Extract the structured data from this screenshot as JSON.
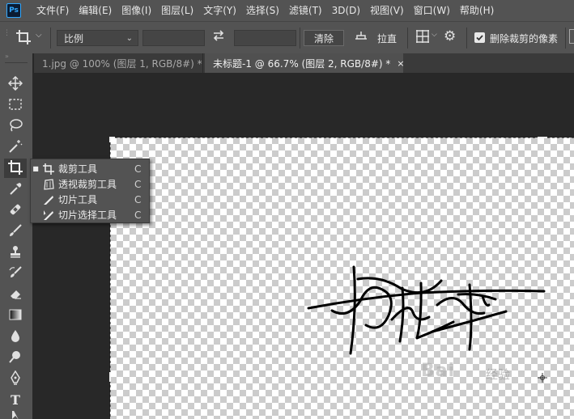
{
  "app": {
    "logo": "Ps"
  },
  "menu": [
    "文件(F)",
    "编辑(E)",
    "图像(I)",
    "图层(L)",
    "文字(Y)",
    "选择(S)",
    "滤镜(T)",
    "3D(D)",
    "视图(V)",
    "窗口(W)",
    "帮助(H)"
  ],
  "options": {
    "ratio_select": "比例",
    "width_value": "",
    "height_value": "",
    "clear_label": "清除",
    "straighten_label": "拉直",
    "delete_cropped_label": "删除裁剪的像素",
    "delete_cropped_checked": true
  },
  "tabs": [
    {
      "label": "1.jpg @ 100% (图层 1, RGB/8#) *",
      "close": "×",
      "active": false
    },
    {
      "label": "未标题-1 @ 66.7% (图层 2, RGB/8#) *",
      "close": "×",
      "active": true
    }
  ],
  "flyout": [
    {
      "label": "裁剪工具",
      "key": "C",
      "selected": true,
      "icon": "crop-icon"
    },
    {
      "label": "透视裁剪工具",
      "key": "C",
      "selected": false,
      "icon": "perspective-crop-icon"
    },
    {
      "label": "切片工具",
      "key": "C",
      "selected": false,
      "icon": "slice-icon"
    },
    {
      "label": "切片选择工具",
      "key": "C",
      "selected": false,
      "icon": "slice-select-icon"
    }
  ],
  "watermark": {
    "text": "Bai",
    "sub": "经验"
  },
  "colors": {
    "panel": "#535353",
    "canvas_bg": "#282828",
    "accent": "#31a8ff"
  }
}
